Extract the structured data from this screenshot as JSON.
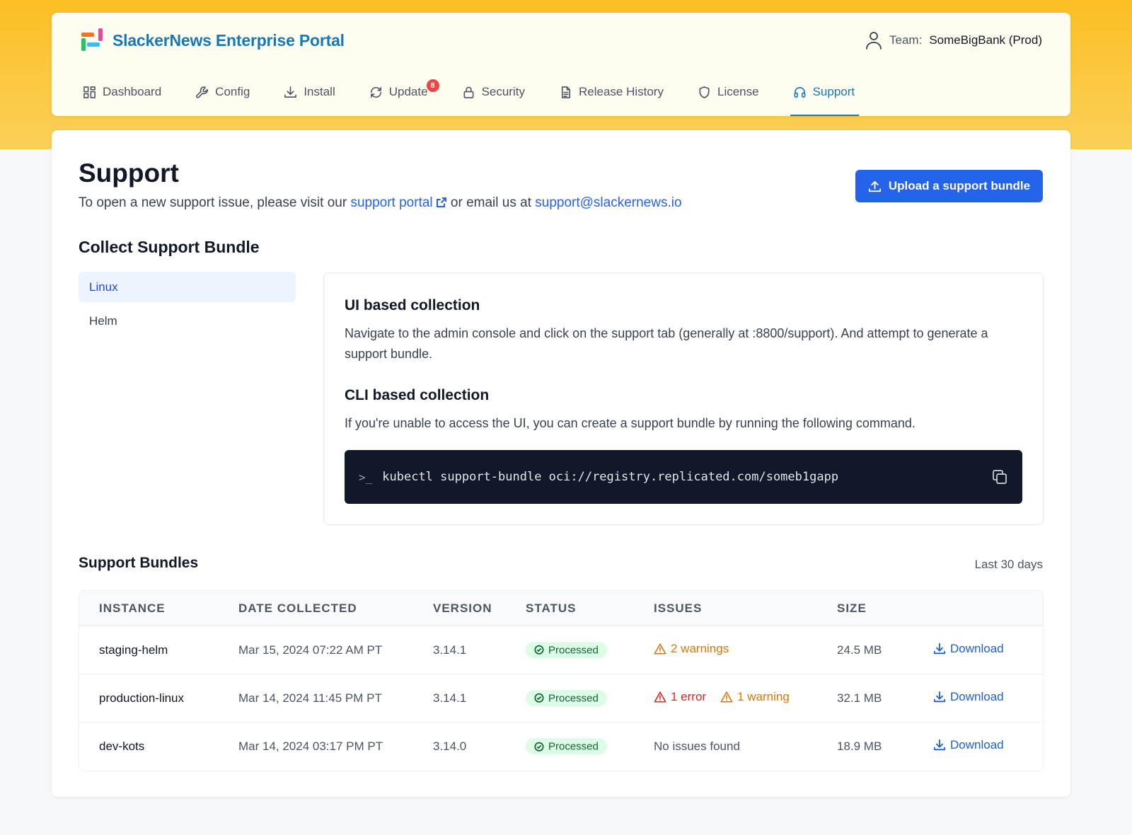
{
  "header": {
    "title": "SlackerNews Enterprise Portal",
    "team_label": "Team:",
    "team_value": "SomeBigBank (Prod)"
  },
  "nav": {
    "dashboard": "Dashboard",
    "config": "Config",
    "install": "Install",
    "update": "Update",
    "update_badge": "8",
    "security": "Security",
    "release_history": "Release History",
    "license": "License",
    "support": "Support"
  },
  "page": {
    "title": "Support",
    "intro_prefix": "To open a new support issue, please visit our",
    "portal_link": "support portal",
    "intro_middle": "or email us at",
    "email_link": "support@slackernews.io",
    "upload_label": "Upload a support bundle"
  },
  "collect": {
    "title": "Collect Support Bundle",
    "tabs": [
      "Linux",
      "Helm"
    ],
    "ui_title": "UI based collection",
    "ui_text": "Navigate to the admin console and click on the support tab (generally at :8800/support). And attempt to generate a support bundle.",
    "cli_title": "CLI based collection",
    "cli_text": "If you're unable to access the UI, you can create a support bundle by running the following command.",
    "command": "kubectl support-bundle oci://registry.replicated.com/someb1gapp"
  },
  "bundles": {
    "title": "Support Bundles",
    "range": "Last 30 days",
    "columns": [
      "INSTANCE",
      "DATE COLLECTED",
      "VERSION",
      "STATUS",
      "ISSUES",
      "SIZE"
    ],
    "rows": [
      {
        "instance": "staging-helm",
        "date": "Mar 15, 2024 07:22 AM PT",
        "version": "3.14.1",
        "status": "Processed",
        "errors": "",
        "warnings": "2 warnings",
        "none": "",
        "size": "24.5 MB",
        "action": "Download"
      },
      {
        "instance": "production-linux",
        "date": "Mar 14, 2024 11:45 PM PT",
        "version": "3.14.1",
        "status": "Processed",
        "errors": "1 error",
        "warnings": "1 warning",
        "none": "",
        "size": "32.1 MB",
        "action": "Download"
      },
      {
        "instance": "dev-kots",
        "date": "Mar 14, 2024 03:17 PM PT",
        "version": "3.14.0",
        "status": "Processed",
        "errors": "",
        "warnings": "",
        "none": "No issues found",
        "size": "18.9 MB",
        "action": "Download"
      }
    ]
  },
  "colors": {
    "accent": "#1579b8",
    "primary_button": "#2563eb",
    "band": "#fbbf24",
    "error": "#dc2626",
    "warning": "#d97706",
    "success_bg": "#dcfce7"
  }
}
